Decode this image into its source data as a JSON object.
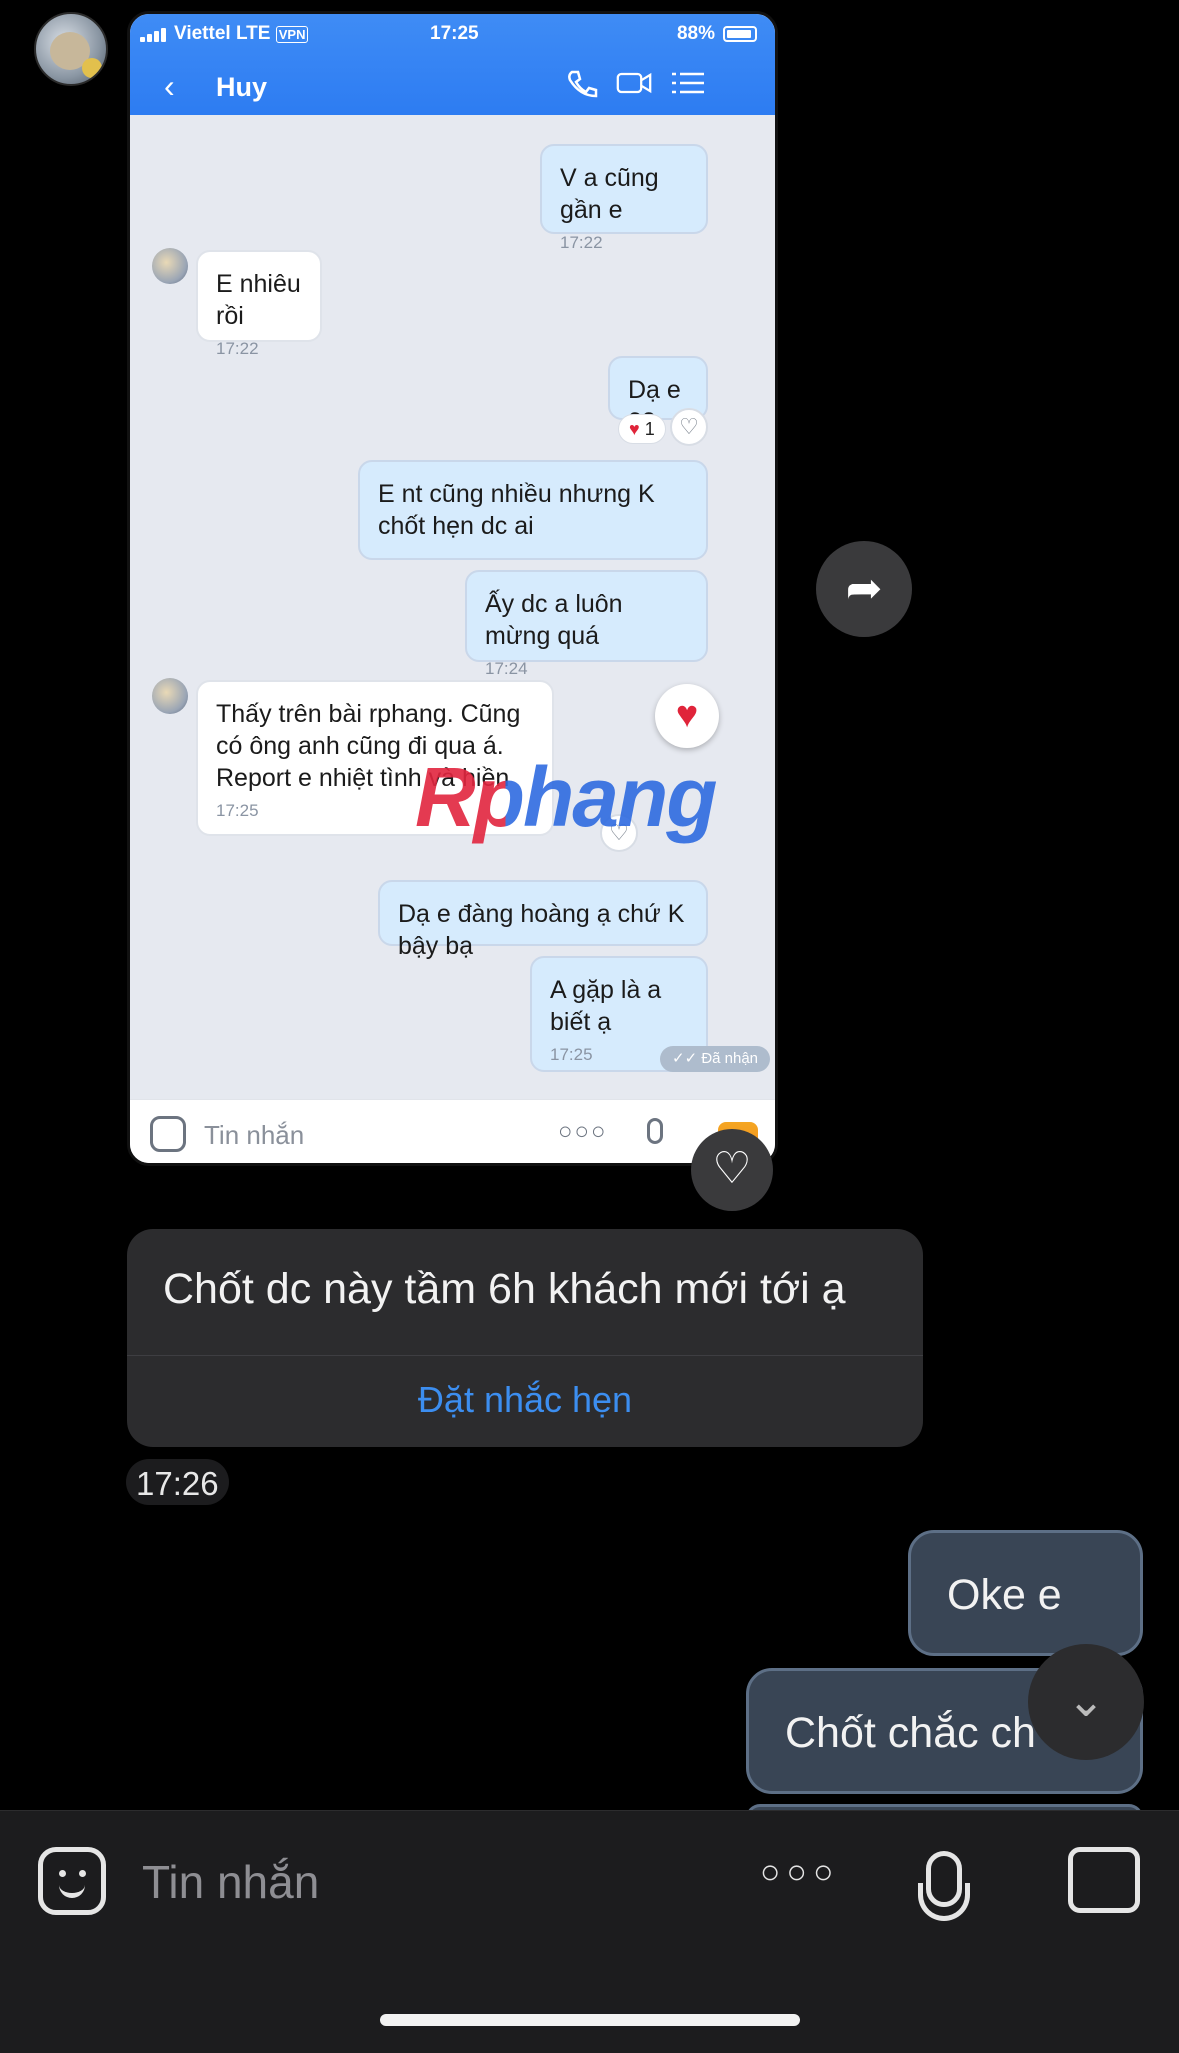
{
  "embedded_screenshot": {
    "status_bar": {
      "carrier": "Viettel",
      "network": "LTE",
      "vpn": "VPN",
      "time": "17:25",
      "battery": "88%"
    },
    "header": {
      "contact_name": "Huy"
    },
    "messages": [
      {
        "text": "V a cũng gần e",
        "time": "17:22"
      },
      {
        "text": "E nhiêu rồi",
        "time": "17:22"
      },
      {
        "text": "Dạ e 23",
        "reaction": "1"
      },
      {
        "text": "E nt cũng nhiều nhưng K chốt hẹn dc ai"
      },
      {
        "text": "Ấy dc a luôn mừng quá",
        "time": "17:24"
      },
      {
        "text": "Thấy trên bài rphang. Cũng có ông anh cũng đi qua á. Report e nhiệt tình và hiền",
        "time": "17:25"
      },
      {
        "text": "Dạ e đàng hoàng ạ chứ K bậy bạ"
      },
      {
        "text": "A gặp là a biết ạ",
        "time": "17:25"
      }
    ],
    "received_label": "Đã nhận",
    "watermark": "Rphang",
    "input_placeholder": "Tin nhắn"
  },
  "chat": {
    "quoted_message": "Chốt dc này tầm 6h khách mới tới ạ",
    "reminder_action": "Đặt nhắc hẹn",
    "timestamp": "17:26",
    "outgoing": [
      "Oke e",
      "Chốt chắc ch"
    ]
  },
  "composer": {
    "placeholder": "Tin nhắn"
  },
  "icons": [
    "share-icon",
    "heart-icon",
    "scroll-down-icon",
    "emoji-icon",
    "more-icon",
    "mic-icon",
    "image-icon"
  ],
  "colors": {
    "accent": "#3c8ef0",
    "header_blue": "#2d7cf2",
    "out_bubble": "#394555"
  }
}
